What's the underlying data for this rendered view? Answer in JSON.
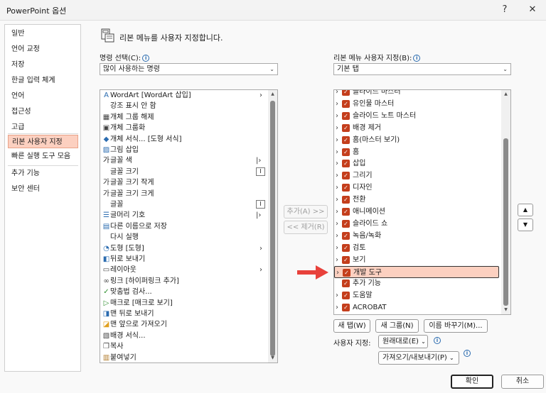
{
  "window": {
    "title": "PowerPoint 옵션",
    "help": "?",
    "close": "✕"
  },
  "nav": {
    "items": [
      {
        "label": "일반"
      },
      {
        "label": "언어 교정"
      },
      {
        "label": "저장"
      },
      {
        "label": "한글 입력 체계"
      },
      {
        "label": "언어"
      },
      {
        "label": "접근성"
      },
      {
        "label": "고급"
      },
      {
        "label": "리본 사용자 지정",
        "selected": true
      },
      {
        "label": "빠른 실행 도구 모음"
      },
      {
        "label": "추가 기능"
      },
      {
        "label": "보안 센터"
      }
    ]
  },
  "header": {
    "text": "리본 메뉴를 사용자 지정합니다."
  },
  "commands": {
    "label": "명령 선택(C):",
    "dropdown_value": "많이 사용하는 명령",
    "items": [
      {
        "label": "WordArt [WordArt 삽입]",
        "icon": "wordart-icon",
        "indicator": "arrow"
      },
      {
        "label": "강조 표시 안 함",
        "icon": "none",
        "indicator": ""
      },
      {
        "label": "개체 그룹 해제",
        "icon": "ungroup-icon",
        "indicator": ""
      },
      {
        "label": "개체 그룹화",
        "icon": "group-icon",
        "indicator": ""
      },
      {
        "label": "개체 서식... [도형 서식]",
        "icon": "format-shape-icon",
        "indicator": ""
      },
      {
        "label": "그림 삽입",
        "icon": "picture-icon",
        "indicator": ""
      },
      {
        "label": "글꼴 색",
        "icon": "font-color-icon",
        "indicator": "split"
      },
      {
        "label": "글꼴 크기",
        "icon": "none",
        "indicator": "box"
      },
      {
        "label": "글꼴 크기 작게",
        "icon": "font-shrink-icon",
        "indicator": ""
      },
      {
        "label": "글꼴 크기 크게",
        "icon": "font-grow-icon",
        "indicator": ""
      },
      {
        "label": "글꼴",
        "icon": "none",
        "indicator": "box"
      },
      {
        "label": "글머리 기호",
        "icon": "bullets-icon",
        "indicator": "split"
      },
      {
        "label": "다른 이름으로 저장",
        "icon": "save-as-icon",
        "indicator": ""
      },
      {
        "label": "다시 실행",
        "icon": "none",
        "indicator": ""
      },
      {
        "label": "도형 [도형]",
        "icon": "shapes-icon",
        "indicator": "arrow"
      },
      {
        "label": "뒤로 보내기",
        "icon": "send-backward-icon",
        "indicator": ""
      },
      {
        "label": "레이아웃",
        "icon": "layout-icon",
        "indicator": "arrow"
      },
      {
        "label": "링크 [하이퍼링크 추가]",
        "icon": "link-icon",
        "indicator": ""
      },
      {
        "label": "맞춤법 검사...",
        "icon": "spelling-icon",
        "indicator": ""
      },
      {
        "label": "매크로 [매크로 보기]",
        "icon": "macro-icon",
        "indicator": ""
      },
      {
        "label": "맨 뒤로 보내기",
        "icon": "send-to-back-icon",
        "indicator": ""
      },
      {
        "label": "맨 앞으로 가져오기",
        "icon": "bring-to-front-icon",
        "indicator": ""
      },
      {
        "label": "배경 서식...",
        "icon": "background-icon",
        "indicator": ""
      },
      {
        "label": "복사",
        "icon": "copy-icon",
        "indicator": ""
      },
      {
        "label": "붙여넣기",
        "icon": "paste-icon",
        "indicator": ""
      }
    ]
  },
  "middle": {
    "add": "추가(A) >>",
    "remove": "<< 제거(R)"
  },
  "ribbon": {
    "label": "리본 메뉴 사용자 지정(B):",
    "dropdown_value": "기본 탭",
    "tabs": [
      {
        "label": "슬라이드 마스터"
      },
      {
        "label": "유인물 마스터"
      },
      {
        "label": "슬라이드 노트 마스터"
      },
      {
        "label": "배경 제거"
      },
      {
        "label": "홈(마스터 보기)"
      },
      {
        "label": "홈"
      },
      {
        "label": "삽입"
      },
      {
        "label": "그리기"
      },
      {
        "label": "디자인"
      },
      {
        "label": "전환"
      },
      {
        "label": "애니메이션"
      },
      {
        "label": "슬라이드 쇼"
      },
      {
        "label": "녹음/녹화"
      },
      {
        "label": "검토"
      },
      {
        "label": "보기"
      },
      {
        "label": "개발 도구",
        "selected": true
      },
      {
        "label": "추가 기능",
        "no_chevron": true
      },
      {
        "label": "도움말"
      },
      {
        "label": "ACROBAT"
      }
    ],
    "new_tab": "새 탭(W)",
    "new_group": "새 그룹(N)",
    "rename": "이름 바꾸기(M)...",
    "customize_label": "사용자 지정:",
    "reset": "원래대로(E)",
    "import_export": "가져오기/내보내기(P)"
  },
  "footer": {
    "ok": "확인",
    "cancel": "취소"
  },
  "colors": {
    "accent": "#c43e1c",
    "selection": "#fcd0c0",
    "arrow": "#e8413b"
  }
}
